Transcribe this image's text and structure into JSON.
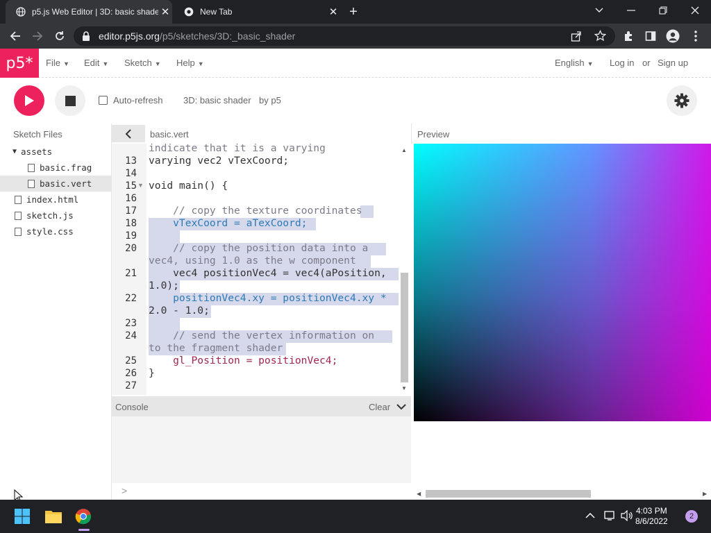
{
  "browser": {
    "tabs": [
      {
        "title": "p5.js Web Editor | 3D: basic shade",
        "active": true
      },
      {
        "title": "New Tab",
        "active": false
      }
    ],
    "url_host": "editor.p5js.org",
    "url_path": "/p5/sketches/3D:_basic_shader"
  },
  "nav": {
    "logo": "p5*",
    "menus": [
      "File",
      "Edit",
      "Sketch",
      "Help"
    ],
    "language": "English",
    "login": "Log in",
    "or": "or",
    "signup": "Sign up"
  },
  "toolbar": {
    "auto_refresh_label": "Auto-refresh",
    "auto_refresh_checked": false,
    "sketch_name": "3D: basic shader",
    "author": "by p5"
  },
  "sidebar": {
    "header": "Sketch Files",
    "items": [
      {
        "name": "assets",
        "type": "folder"
      },
      {
        "name": "basic.frag",
        "type": "file"
      },
      {
        "name": "basic.vert",
        "type": "file",
        "selected": true
      },
      {
        "name": "index.html",
        "type": "file"
      },
      {
        "name": "sketch.js",
        "type": "file"
      },
      {
        "name": "style.css",
        "type": "file"
      }
    ]
  },
  "editor": {
    "filename": "basic.vert",
    "line_numbers": [
      "13",
      "14",
      "15",
      "16",
      "17",
      "18",
      "19",
      "20",
      "21",
      "22",
      "23",
      "24",
      "25",
      "26",
      "27"
    ],
    "lines": [
      "indicate that it is a varying",
      "varying vec2 vTexCoord;",
      "",
      "void main() {",
      "",
      "    // copy the texture coordinates",
      "    vTexCoord = aTexCoord;",
      "",
      "    // copy the position data into a",
      "vec4, using 1.0 as the w component",
      "    vec4 positionVec4 = vec4(aPosition,",
      "1.0);",
      "    positionVec4.xy = positionVec4.xy *",
      "2.0 - 1.0;",
      "",
      "    // send the vertex information on",
      "to the fragment shader",
      "    gl_Position = positionVec4;",
      "}",
      ""
    ]
  },
  "console": {
    "label": "Console",
    "clear": "Clear",
    "prompt": ">"
  },
  "preview": {
    "label": "Preview"
  },
  "taskbar": {
    "time": "4:03 PM",
    "date": "8/6/2022",
    "notifications": "2"
  },
  "colors": {
    "accent": "#ed225d",
    "chrome_dark": "#202124",
    "chrome_mid": "#35363a",
    "selection": "#d6d9ec"
  }
}
